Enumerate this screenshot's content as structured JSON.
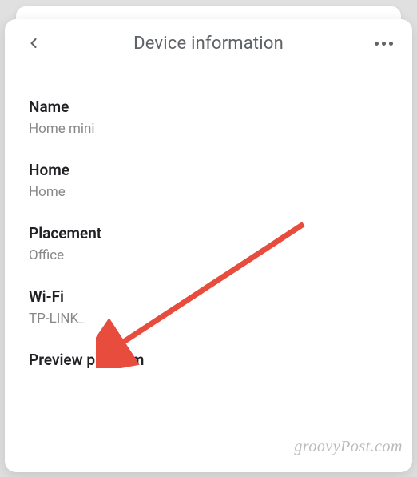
{
  "header": {
    "title": "Device information"
  },
  "sections": {
    "name": {
      "label": "Name",
      "value": "Home mini"
    },
    "home": {
      "label": "Home",
      "value": "Home"
    },
    "placement": {
      "label": "Placement",
      "value": "Office"
    },
    "wifi": {
      "label": "Wi-Fi",
      "value": "TP-LINK_"
    },
    "preview": {
      "label": "Preview program"
    }
  },
  "watermark": "groovyPost.com"
}
